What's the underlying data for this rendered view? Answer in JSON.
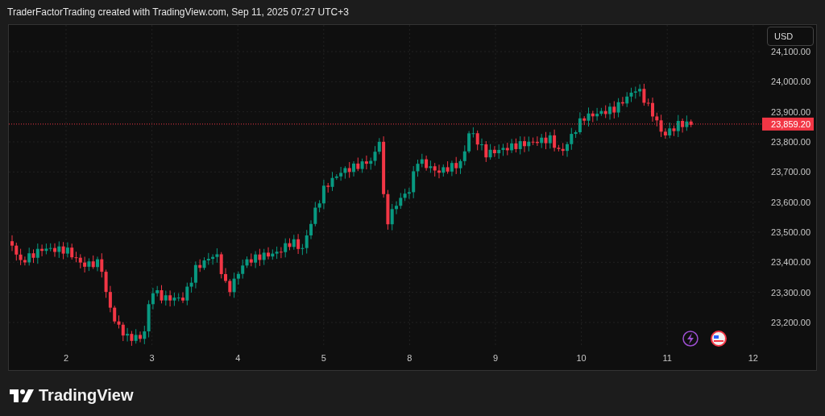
{
  "header": {
    "caption": "TraderFactorTrading created with TradingView.com, Sep 11, 2025 07:27 UTC+3"
  },
  "chart": {
    "currency_button": "USD",
    "price_labels": [
      "24,100.00",
      "24,000.00",
      "23,900.00",
      "23,800.00",
      "23,700.00",
      "23,600.00",
      "23,500.00",
      "23,400.00",
      "23,300.00",
      "23,200.00"
    ],
    "time_labels": [
      "2",
      "3",
      "4",
      "5",
      "8",
      "9",
      "10",
      "11",
      "12"
    ],
    "last_price": {
      "label": "23,859.20",
      "color": "#f23645"
    }
  },
  "footer": {
    "brand": "TradingView"
  }
}
